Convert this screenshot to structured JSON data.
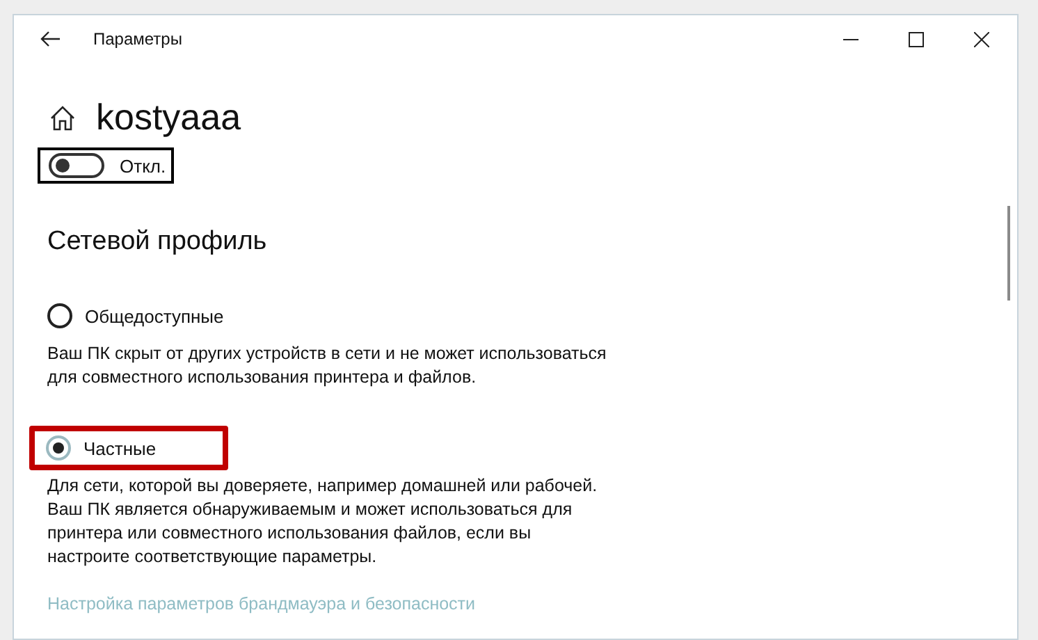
{
  "window": {
    "title": "Параметры"
  },
  "page": {
    "title": "kostyaaa"
  },
  "toggle": {
    "on": false,
    "label": "Откл.",
    "focused": true
  },
  "section": {
    "title": "Сетевой профиль"
  },
  "profiles": [
    {
      "label": "Общедоступные",
      "selected": false,
      "highlighted": false,
      "description": [
        "Ваш ПК скрыт от других устройств в сети и не может использоваться",
        "для совместного использования принтера и файлов."
      ]
    },
    {
      "label": "Частные",
      "selected": true,
      "highlighted": true,
      "description": [
        "Для сети, которой вы доверяете, например домашней или рабочей.",
        "Ваш ПК является обнаруживаемым и может использоваться для",
        "принтера или совместного использования файлов, если вы",
        "настроите соответствующие параметры."
      ]
    }
  ],
  "link": {
    "label": "Настройка параметров брандмауэра и безопасности"
  }
}
